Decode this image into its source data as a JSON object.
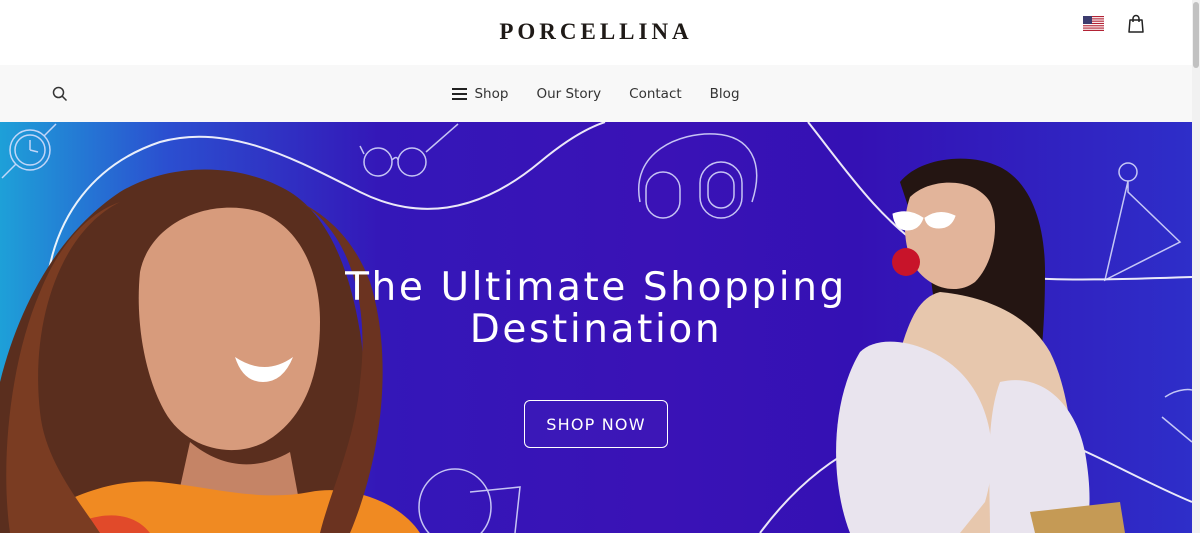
{
  "header": {
    "logo": "PORCELLINA",
    "flag_icon": "us-flag-icon",
    "cart_icon": "shopping-bag-icon"
  },
  "nav": {
    "search_icon": "search-icon",
    "items": [
      {
        "label": "Shop",
        "icon": "hamburger-menu-icon"
      },
      {
        "label": "Our Story"
      },
      {
        "label": "Contact"
      },
      {
        "label": "Blog"
      }
    ]
  },
  "hero": {
    "title_line1": "The Ultimate Shopping",
    "title_line2": "Destination",
    "cta_label": "SHOP NOW",
    "colors": {
      "gradient_left": "#1ea0d8",
      "gradient_mid": "#3a12b6",
      "gradient_right": "#2e2ec9"
    }
  }
}
